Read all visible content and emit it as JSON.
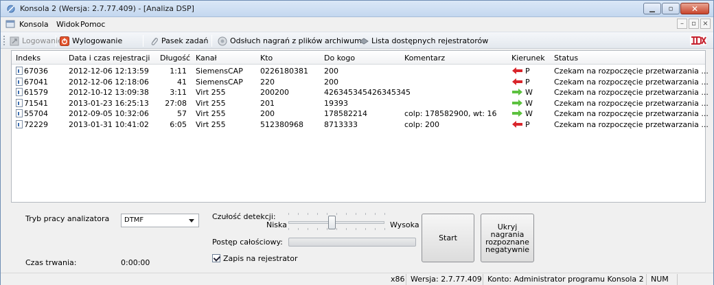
{
  "window": {
    "title": "Konsola 2 (Wersja:  2.7.77.409) - [Analiza DSP]"
  },
  "menu": [
    "Konsola",
    "Widok",
    "Pomoc"
  ],
  "toolbar": {
    "login": "Logowanie",
    "logout": "Wylogowanie",
    "taskbar": "Pasek zadań",
    "archive": "Odsłuch nagrań z plików archiwum",
    "recorders": "Lista dostępnych rejestratorów"
  },
  "columns": [
    "Indeks",
    "Data i czas rejestracji",
    "Długość",
    "Kanał",
    "Kto",
    "Do kogo",
    "Komentarz",
    "Kierunek",
    "Status"
  ],
  "rows": [
    {
      "index": "67036",
      "datetime": "2012-12-06 12:13:59",
      "length": "1:11",
      "channel": "SiemensCAP",
      "who": "0226180381",
      "to": "200",
      "comment": "",
      "direction": "P",
      "status": "Czekam na rozpoczęcie przetwarzania ..."
    },
    {
      "index": "67041",
      "datetime": "2012-12-06 12:18:06",
      "length": "41",
      "channel": "SiemensCAP",
      "who": "220",
      "to": "200",
      "comment": "",
      "direction": "P",
      "status": "Czekam na rozpoczęcie przetwarzania ..."
    },
    {
      "index": "61579",
      "datetime": "2012-10-12 13:09:38",
      "length": "3:11",
      "channel": "Virt 255",
      "who": "200200",
      "to": "426345345426345345",
      "comment": "",
      "direction": "W",
      "status": "Czekam na rozpoczęcie przetwarzania ..."
    },
    {
      "index": "71541",
      "datetime": "2013-01-23 16:25:13",
      "length": "27:08",
      "channel": "Virt 255",
      "who": "201",
      "to": "19393",
      "comment": "",
      "direction": "W",
      "status": "Czekam na rozpoczęcie przetwarzania ..."
    },
    {
      "index": "55704",
      "datetime": "2012-09-05 10:32:06",
      "length": "57",
      "channel": "Virt 255",
      "who": "200",
      "to": "178582214",
      "comment": "colp: 178582900, wt: 16",
      "direction": "W",
      "status": "Czekam na rozpoczęcie przetwarzania ..."
    },
    {
      "index": "72229",
      "datetime": "2013-01-31 10:41:02",
      "length": "6:05",
      "channel": "Virt 255",
      "who": "512380968",
      "to": "8713333",
      "comment": "colp: 200",
      "direction": "P",
      "status": "Czekam na rozpoczęcie przetwarzania ..."
    }
  ],
  "colors": {
    "incoming": "#d9252b",
    "outgoing": "#5cc13e"
  },
  "panel": {
    "mode_label": "Tryb pracy analizatora",
    "mode_value": "DTMF",
    "sensitivity_label": "Czułość detekcji:",
    "low_label": "Niska",
    "high_label": "Wysoka",
    "sensitivity_level": 0.45,
    "progress_label": "Postęp całościowy:",
    "progress_value": 0,
    "save_label": "Zapis na rejestrator",
    "duration_label": "Czas trwania:",
    "duration_value": "0:00:00",
    "start_label": "Start",
    "hide_label": "Ukryj nagrania rozpoznane negatywnie"
  },
  "status": {
    "arch": "x86",
    "version": "Wersja: 2.7.77.409",
    "account": "Konto: Administrator programu Konsola 2",
    "num": "NUM"
  }
}
